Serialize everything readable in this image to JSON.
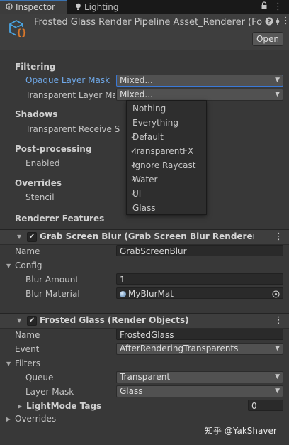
{
  "tabs": {
    "inspector": "Inspector",
    "lighting": "Lighting"
  },
  "header": {
    "title": "Frosted Glass Render Pipeline Asset_Renderer (Fo",
    "open_label": "Open"
  },
  "filtering": {
    "title": "Filtering",
    "opaque_label": "Opaque Layer Mask",
    "opaque_value": "Mixed...",
    "transparent_label": "Transparent Layer Mas",
    "transparent_value": "Mixed..."
  },
  "shadows": {
    "title": "Shadows",
    "transparent_receive_label": "Transparent Receive S"
  },
  "post_processing": {
    "title": "Post-processing",
    "enabled_label": "Enabled"
  },
  "overrides": {
    "title": "Overrides",
    "stencil_label": "Stencil"
  },
  "renderer_features_title": "Renderer Features",
  "layer_menu": {
    "items": [
      {
        "label": "Nothing",
        "checked": false
      },
      {
        "label": "Everything",
        "checked": false
      },
      {
        "label": "Default",
        "checked": true
      },
      {
        "label": "TransparentFX",
        "checked": true
      },
      {
        "label": "Ignore Raycast",
        "checked": true
      },
      {
        "label": "Water",
        "checked": true
      },
      {
        "label": "UI",
        "checked": true
      },
      {
        "label": "Glass",
        "checked": false
      }
    ]
  },
  "grab_feature": {
    "title": "Grab Screen Blur (Grab Screen Blur Renderer Featu",
    "name_label": "Name",
    "name_value": "GrabScreenBlur",
    "config_label": "Config",
    "blur_amount_label": "Blur Amount",
    "blur_amount_value": "1",
    "blur_material_label": "Blur Material",
    "blur_material_value": "MyBlurMat"
  },
  "frosted_feature": {
    "title": "Frosted Glass (Render Objects)",
    "name_label": "Name",
    "name_value": "FrostedGlass",
    "event_label": "Event",
    "event_value": "AfterRenderingTransparents",
    "filters_label": "Filters",
    "queue_label": "Queue",
    "queue_value": "Transparent",
    "layer_mask_label": "Layer Mask",
    "layer_mask_value": "Glass",
    "lightmode_label": "LightMode Tags",
    "lightmode_value": "0",
    "overrides_label": "Overrides"
  },
  "watermark": "知乎 @YakShaver",
  "colors": {
    "background": "#383838",
    "selected_label": "#6fa8e8",
    "focus_outline": "#3a79d8"
  },
  "icons": [
    "inspector-icon",
    "lighting-icon",
    "lock-icon",
    "menu-icon",
    "asset-icon",
    "help-icon",
    "settings-icon",
    "more-icon",
    "checkmark-icon",
    "chevron-down-icon",
    "foldout-icon",
    "material-icon",
    "object-picker-icon"
  ]
}
